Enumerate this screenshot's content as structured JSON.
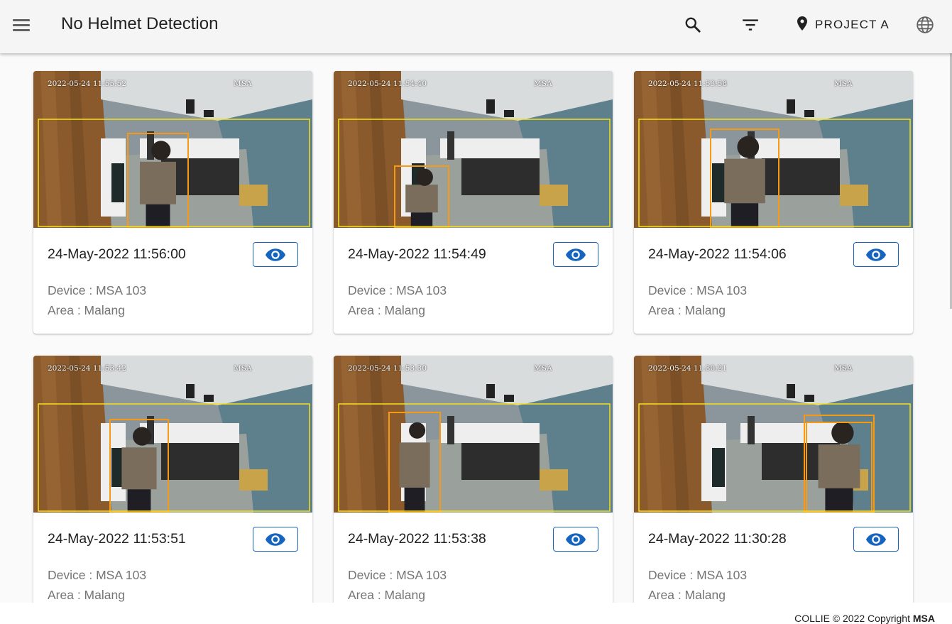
{
  "header": {
    "title": "No Helmet Detection",
    "project_label": "PROJECT A"
  },
  "icons": {
    "menu": "menu-icon",
    "search": "search-icon",
    "filter": "filter-icon",
    "location": "location-pin-icon",
    "language": "globe-icon",
    "view": "eye-icon"
  },
  "colors": {
    "accent": "#1565c0",
    "bbox_outer": "#f5e11a",
    "bbox_person": "#f59a12"
  },
  "cards": [
    {
      "time": "24-May-2022 11:56:00",
      "cam_ts": "2022-05-24 11:55:52",
      "cam_tag": "MSA",
      "device": "Device : MSA 103",
      "area": "Area : Malang"
    },
    {
      "time": "24-May-2022 11:54:49",
      "cam_ts": "2022-05-24 11:54:40",
      "cam_tag": "MSA",
      "device": "Device : MSA 103",
      "area": "Area : Malang"
    },
    {
      "time": "24-May-2022 11:54:06",
      "cam_ts": "2022-05-24 11:53:58",
      "cam_tag": "MSA",
      "device": "Device : MSA 103",
      "area": "Area : Malang"
    },
    {
      "time": "24-May-2022 11:53:51",
      "cam_ts": "2022-05-24 11:53:42",
      "cam_tag": "MSA",
      "device": "Device : MSA 103",
      "area": "Area : Malang"
    },
    {
      "time": "24-May-2022 11:53:38",
      "cam_ts": "2022-05-24 11:53:30",
      "cam_tag": "MSA",
      "device": "Device : MSA 103",
      "area": "Area : Malang"
    },
    {
      "time": "24-May-2022 11:30:28",
      "cam_ts": "2022-05-24 11:30:21",
      "cam_tag": "MSA",
      "device": "Device : MSA 103",
      "area": "Area : Malang"
    }
  ],
  "footer": {
    "copyright": "COLLIE © 2022 Copyright",
    "brand": "MSA"
  }
}
